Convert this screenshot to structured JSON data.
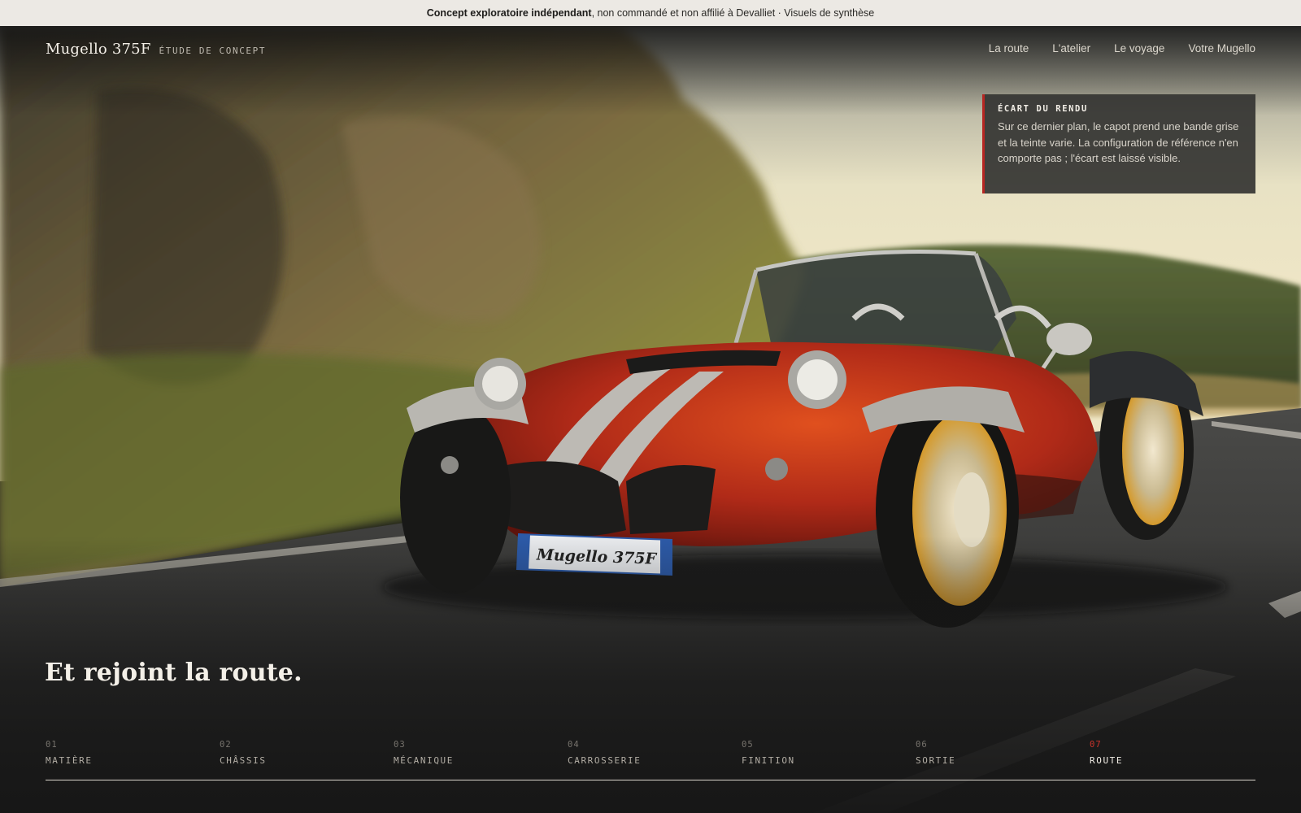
{
  "disclaimer": {
    "bold": "Concept exploratoire indépendant",
    "rest": ", non commandé et non affilié à Devalliet · Visuels de synthèse"
  },
  "brand": {
    "name": "Mugello 375F",
    "tagline": "ÉTUDE DE CONCEPT"
  },
  "nav": {
    "items": [
      {
        "label": "La route"
      },
      {
        "label": "L'atelier"
      },
      {
        "label": "Le voyage"
      },
      {
        "label": "Votre Mugello"
      }
    ]
  },
  "note": {
    "title": "ÉCART DU RENDU",
    "body": "Sur ce dernier plan, le capot prend une bande grise et la teinte varie. La configuration de référence n'en comporte pas ; l'écart est laissé visible."
  },
  "hero": {
    "headline": "Et rejoint la route.",
    "plate_text": "Mugello 375F"
  },
  "chapters": {
    "active_index": 6,
    "items": [
      {
        "num": "01",
        "label": "MATIÈRE"
      },
      {
        "num": "02",
        "label": "CHÂSSIS"
      },
      {
        "num": "03",
        "label": "MÉCANIQUE"
      },
      {
        "num": "04",
        "label": "CARROSSERIE"
      },
      {
        "num": "05",
        "label": "FINITION"
      },
      {
        "num": "06",
        "label": "SORTIE"
      },
      {
        "num": "07",
        "label": "ROUTE"
      }
    ]
  },
  "colors": {
    "accent": "#c9332b",
    "car_body": "#b8321c",
    "disclaimer_bg": "#ece9e4"
  }
}
